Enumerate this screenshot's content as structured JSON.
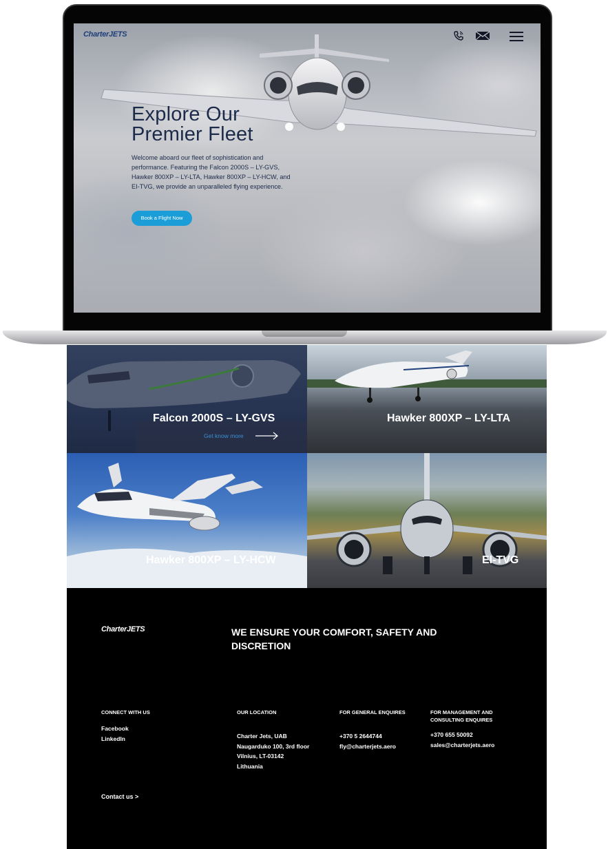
{
  "header": {
    "logo": {
      "part1": "Charter",
      "part2": "JETS"
    },
    "icons": [
      "phone-icon",
      "mail-icon",
      "menu-icon"
    ]
  },
  "hero": {
    "title_line1": "Explore Our",
    "title_line2": "Premier Fleet",
    "description": "Welcome aboard our fleet of sophistication and performance. Featuring the Falcon 2000S – LY-GVS, Hawker 800XP – LY-LTA, Hawker 800XP – LY-HCW, and EI-TVG, we provide an unparalleled flying experience.",
    "cta_label": "Book a Flight Now",
    "cta_color": "#1b9ed8"
  },
  "fleet": {
    "tiles": [
      {
        "label": "Falcon 2000S – LY-GVS",
        "link": "Get know more"
      },
      {
        "label": "Hawker 800XP – LY-LTA"
      },
      {
        "label": "Hawker 800XP – LY-HCW"
      },
      {
        "label": "EI-TVG"
      }
    ]
  },
  "footer": {
    "logo": {
      "part1": "Charter",
      "part2": "JETS"
    },
    "tagline": "WE ENSURE YOUR COMFORT, SAFETY AND DISCRETION",
    "connect": {
      "heading": "CONNECT WITH US",
      "links": [
        "Facebook",
        "LinkedIn"
      ]
    },
    "location": {
      "heading": "OUR LOCATION",
      "lines": [
        "Charter Jets, UAB",
        "Naugarduko 100, 3rd floor",
        "Vilnius, LT-03142",
        "Lithuania"
      ]
    },
    "general": {
      "heading": "FOR GENERAL ENQUIRES",
      "phone": "+370 5 2644744",
      "email": "fly@charterjets.aero"
    },
    "management": {
      "heading_line1": "FOR MANAGEMENT AND",
      "heading_line2": "CONSULTING ENQUIRES",
      "phone": "+370 655 50092",
      "email": "sales@charterjets.aero"
    },
    "contact_label": "Contact us >"
  }
}
